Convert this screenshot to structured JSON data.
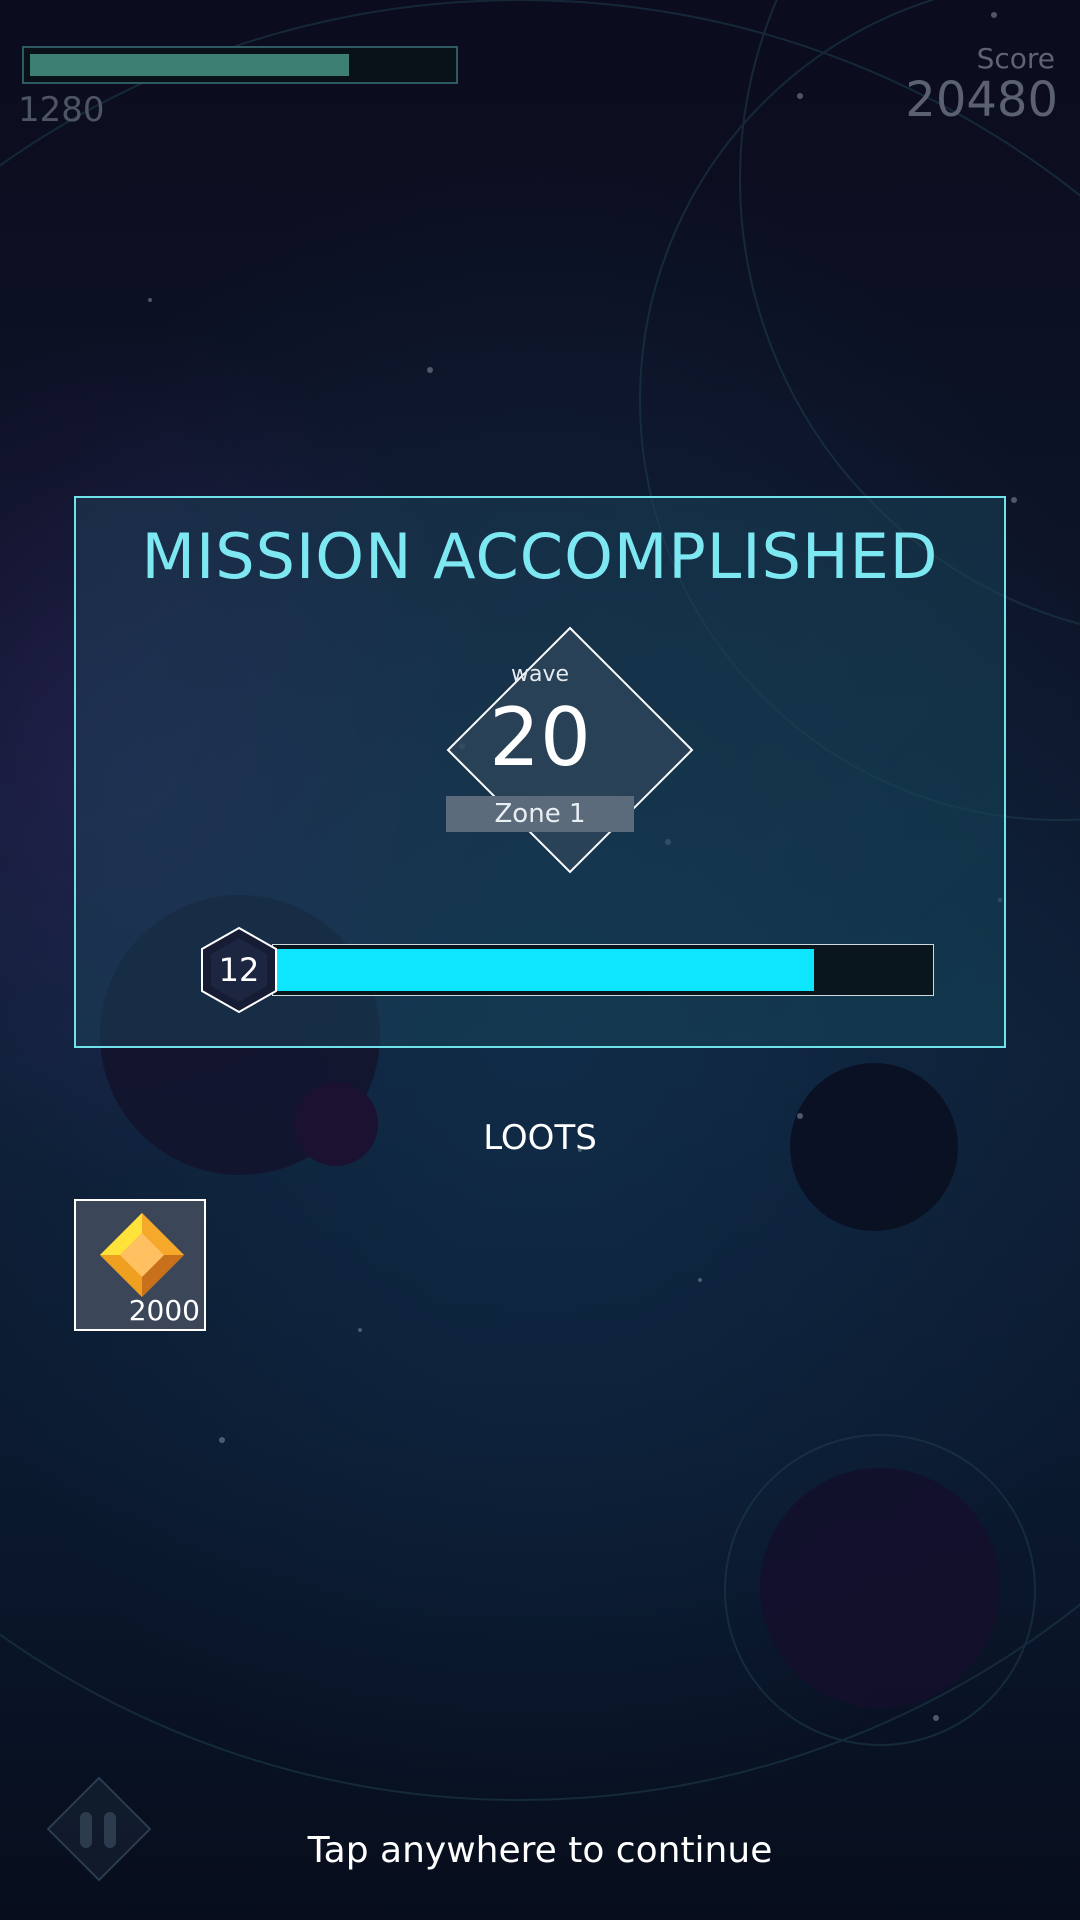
{
  "hud": {
    "health_value": "1280",
    "health_fraction": 0.76,
    "score_label": "Score",
    "score_value": "20480"
  },
  "mission": {
    "title": "MISSION ACCOMPLISHED",
    "wave_label": "wave",
    "wave_number": "20",
    "zone": "Zone 1",
    "level": "12",
    "xp_fraction": 0.82
  },
  "loots": {
    "title": "LOOTS",
    "items": [
      {
        "icon": "gold-gem-icon",
        "amount": "2000"
      }
    ]
  },
  "footer": {
    "continue_text": "Tap anywhere to continue",
    "pause_icon": "pause-icon"
  },
  "colors": {
    "accent_cyan": "#0ee5ff",
    "title_cyan": "#7ee8f2",
    "health_green": "#3d7f73",
    "gem_gold": "#f5a623"
  }
}
